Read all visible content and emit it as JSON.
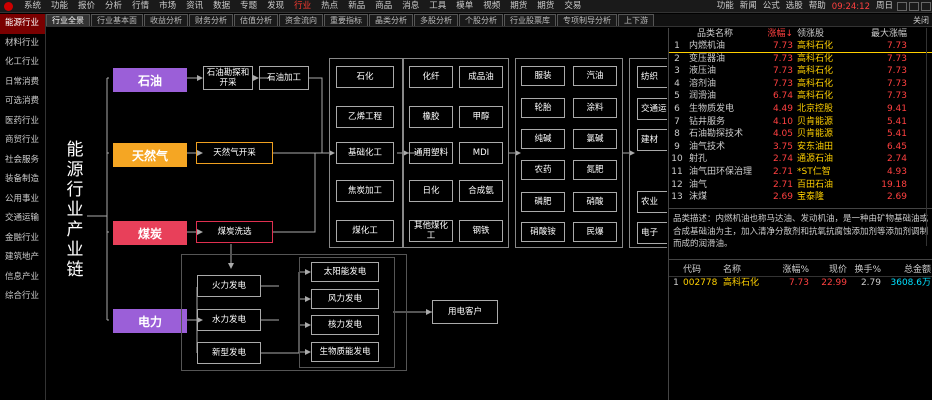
{
  "menu": [
    "系统",
    "功能",
    "报价",
    "分析",
    "行情",
    "市场",
    "资讯",
    "数据",
    "专题",
    "发现",
    "行业",
    "热点",
    "新品",
    "商品",
    "消息",
    "工具",
    "模单",
    "视频",
    "期货",
    "期货",
    "交易"
  ],
  "menu_active_index": 10,
  "menu_right": [
    "功能",
    "新闻",
    "公式",
    "选股",
    "帮助"
  ],
  "time": "09:24:12",
  "time_suffix": "周日",
  "tabs": [
    "行业全景",
    "行业基本面",
    "收益分析",
    "财务分析",
    "估值分析",
    "资金流向",
    "重要指标",
    "晶类分析",
    "多股分析",
    "个股分析",
    "行业股票库",
    "专项制导分析",
    "上下游"
  ],
  "tab_active_index": 0,
  "close_label": "关闭",
  "sidebar": [
    "能源行业",
    "材料行业",
    "化工行业",
    "日常消费",
    "可选消费",
    "医药行业",
    "商贸行业",
    "社会服务",
    "装备制造",
    "公用事业",
    "交通运输",
    "金融行业",
    "建筑地产",
    "信息产业",
    "综合行业"
  ],
  "sidebar_active_index": 0,
  "diagram": {
    "title_chars": [
      "能",
      "源",
      "行",
      "业",
      "产",
      "业",
      "链"
    ],
    "categories": {
      "oil": "石油",
      "gas": "天然气",
      "coal": "煤炭",
      "power": "电力"
    },
    "upstream": {
      "oil_extract": "石油勘探和开采",
      "oil_process": "石油加工",
      "gas_extract": "天然气开采",
      "coal_wash": "煤炭洗选",
      "fire_power": "火力发电",
      "water_power": "水力发电",
      "new_power": "新型发电"
    },
    "col1": [
      "石化",
      "乙烯工程",
      "基础化工",
      "焦炭加工",
      "煤化工"
    ],
    "col2": [
      [
        "化纤",
        "成品油"
      ],
      [
        "橡胶",
        "甲醇"
      ],
      [
        "通用塑料",
        "MDI"
      ],
      [
        "日化",
        "合成氨"
      ],
      [
        "其他煤化工",
        "钢铁"
      ]
    ],
    "col3": [
      [
        "服装",
        "汽油"
      ],
      [
        "轮胎",
        "涂料"
      ],
      [
        "纯碱",
        "氯碱"
      ],
      [
        "农药",
        "氮肥"
      ],
      [
        "磷肥",
        "硝酸"
      ],
      [
        "硝酸铵",
        "民爆"
      ]
    ],
    "col4": [
      "纺织",
      "交通运输",
      "建材",
      "农业",
      "电子"
    ],
    "new_power_types": [
      "太阳能发电",
      "风力发电",
      "核力发电",
      "生物质能发电"
    ],
    "customer": "用电客户"
  },
  "board": {
    "headers": {
      "name": "品类名称",
      "chg": "涨幅↓",
      "lead": "领涨股",
      "lchg": "最大涨幅"
    },
    "rows": [
      {
        "no": "1",
        "name": "内燃机油",
        "chg": "7.73",
        "lead": "高科石化",
        "lchg": "7.73"
      },
      {
        "no": "2",
        "name": "变压器油",
        "chg": "7.73",
        "lead": "高科石化",
        "lchg": "7.73"
      },
      {
        "no": "3",
        "name": "液压油",
        "chg": "7.73",
        "lead": "高科石化",
        "lchg": "7.73"
      },
      {
        "no": "4",
        "name": "溶剂油",
        "chg": "7.73",
        "lead": "高科石化",
        "lchg": "7.73"
      },
      {
        "no": "5",
        "name": "润滑油",
        "chg": "6.74",
        "lead": "高科石化",
        "lchg": "7.73"
      },
      {
        "no": "6",
        "name": "生物质发电",
        "chg": "4.49",
        "lead": "北京控股",
        "lchg": "9.41"
      },
      {
        "no": "7",
        "name": "钻井服务",
        "chg": "4.10",
        "lead": "贝肯能源",
        "lchg": "5.41"
      },
      {
        "no": "8",
        "name": "石油勘探技术",
        "chg": "4.05",
        "lead": "贝肯能源",
        "lchg": "5.41"
      },
      {
        "no": "9",
        "name": "油气技术",
        "chg": "3.75",
        "lead": "安东油田",
        "lchg": "6.45"
      },
      {
        "no": "10",
        "name": "射孔",
        "chg": "2.74",
        "lead": "通源石油",
        "lchg": "2.74"
      },
      {
        "no": "11",
        "name": "油气田环保治理",
        "chg": "2.71",
        "lead": "*ST仁智",
        "lchg": "4.93"
      },
      {
        "no": "12",
        "name": "油气",
        "chg": "2.71",
        "lead": "百田石油",
        "lchg": "19.18"
      },
      {
        "no": "13",
        "name": "沫煤",
        "chg": "2.69",
        "lead": "宝泰隆",
        "lchg": "2.69"
      }
    ]
  },
  "description": "品类描述：内燃机油也称马达油、发动机油，是一种由矿物基础油或合成基础油为主，加入清净分散剂和抗氧抗腐蚀添加剂等添加剂调制而成的润滑油。",
  "stocks": {
    "headers": {
      "code": "代码",
      "name": "名称",
      "chg": "涨幅%",
      "price": "现价",
      "turn": "换手%",
      "cap": "总金额"
    },
    "rows": [
      {
        "no": "1",
        "code": "002778",
        "name": "高科石化",
        "chg": "7.73",
        "price": "22.99",
        "turn": "2.79",
        "cap": "3608.6万"
      }
    ]
  },
  "colors": {
    "oil": "#9b5fd8",
    "gas": "#f5a623",
    "coal": "#e8405a",
    "power": "#9b5fd8",
    "accent": "#ff4040"
  }
}
